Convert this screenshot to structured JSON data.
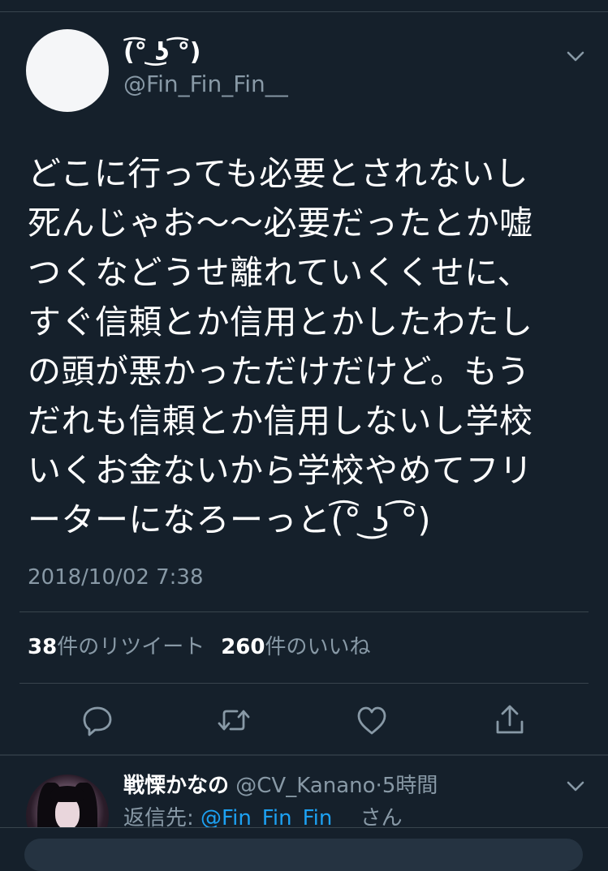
{
  "tweet": {
    "display_name": "(͡° ͜ʖ ͡°)",
    "handle": "@Fin_Fin_Fin__",
    "text_lines": [
      "どこに行っても必要とされないし",
      "死んじゃお〜〜必要だったとか嘘",
      "つくなどうせ離れていくくせに、",
      "すぐ信頼とか信用とかしたわたし",
      "の頭が悪かっただけだけど。もう",
      "だれも信頼とか信用しないし学校",
      "いくお金ないから学校やめてフリ",
      "ーターになろーっと(͡° ͜ʖ ͡°)"
    ],
    "timestamp": "2018/10/02 7:38",
    "retweet_count": "38",
    "retweet_label": "件のリツイート",
    "like_count": "260",
    "like_label": "件のいいね",
    "icons": {
      "menu": "chevron-down-icon",
      "reply": "reply-icon",
      "retweet": "retweet-icon",
      "like": "heart-icon",
      "share": "share-icon"
    }
  },
  "reply": {
    "display_name": "戦慄かなの",
    "handle": "@CV_Kanano",
    "separator": "·",
    "time": "5時間",
    "reply_to_label": "返信先: ",
    "reply_to_mention": "@Fin_Fin_Fin__",
    "reply_to_suffix": "さん"
  },
  "colors": {
    "background": "#15202b",
    "text": "#ffffff",
    "secondary_text": "#8899a6",
    "accent": "#1da1f2",
    "divider": "#38444d"
  }
}
